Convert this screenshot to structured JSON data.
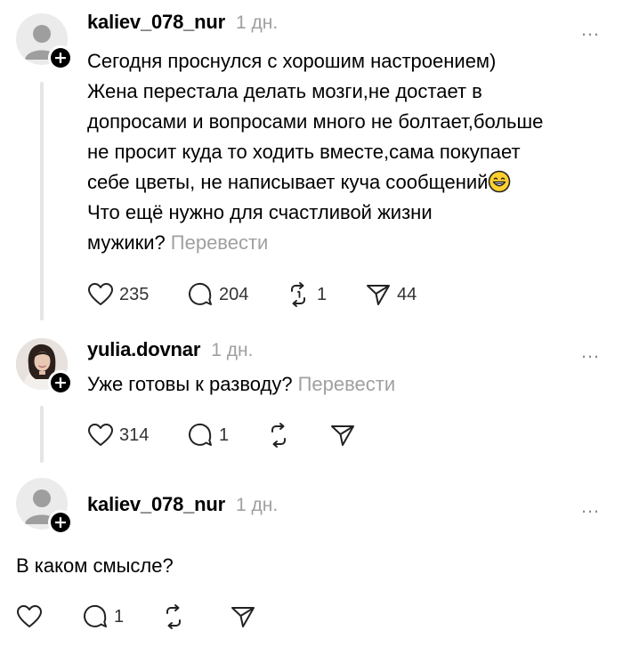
{
  "posts": [
    {
      "username": "kaliev_078_nur",
      "time": "1 дн.",
      "more_icon": "…",
      "lines": [
        "Сегодня проснулся с хорошим настроением)",
        "Жена перестала делать мозги,не достает в",
        "допросами и вопросами много не болтает,больше",
        "не просит куда то ходить вместе,сама покупает",
        "себе цветы, не написывает куча сообщений",
        "Что ещё нужно для счастливой жизни",
        "мужики?"
      ],
      "translate": "Перевести",
      "likes": "235",
      "replies": "204",
      "reposts": "1",
      "shares": "44"
    },
    {
      "username": "yulia.dovnar",
      "time": "1 дн.",
      "more_icon": "…",
      "text": "Уже готовы к разводу?",
      "translate": "Перевести",
      "likes": "314",
      "replies": "1"
    },
    {
      "username": "kaliev_078_nur",
      "time": "1 дн.",
      "more_icon": "…",
      "text": "В каком смысле?",
      "replies": "1"
    }
  ],
  "icons": {
    "like": "heart-icon",
    "reply": "comment-icon",
    "repost": "repost-icon",
    "share": "send-icon",
    "emoji": "grinning-face-emoji"
  }
}
